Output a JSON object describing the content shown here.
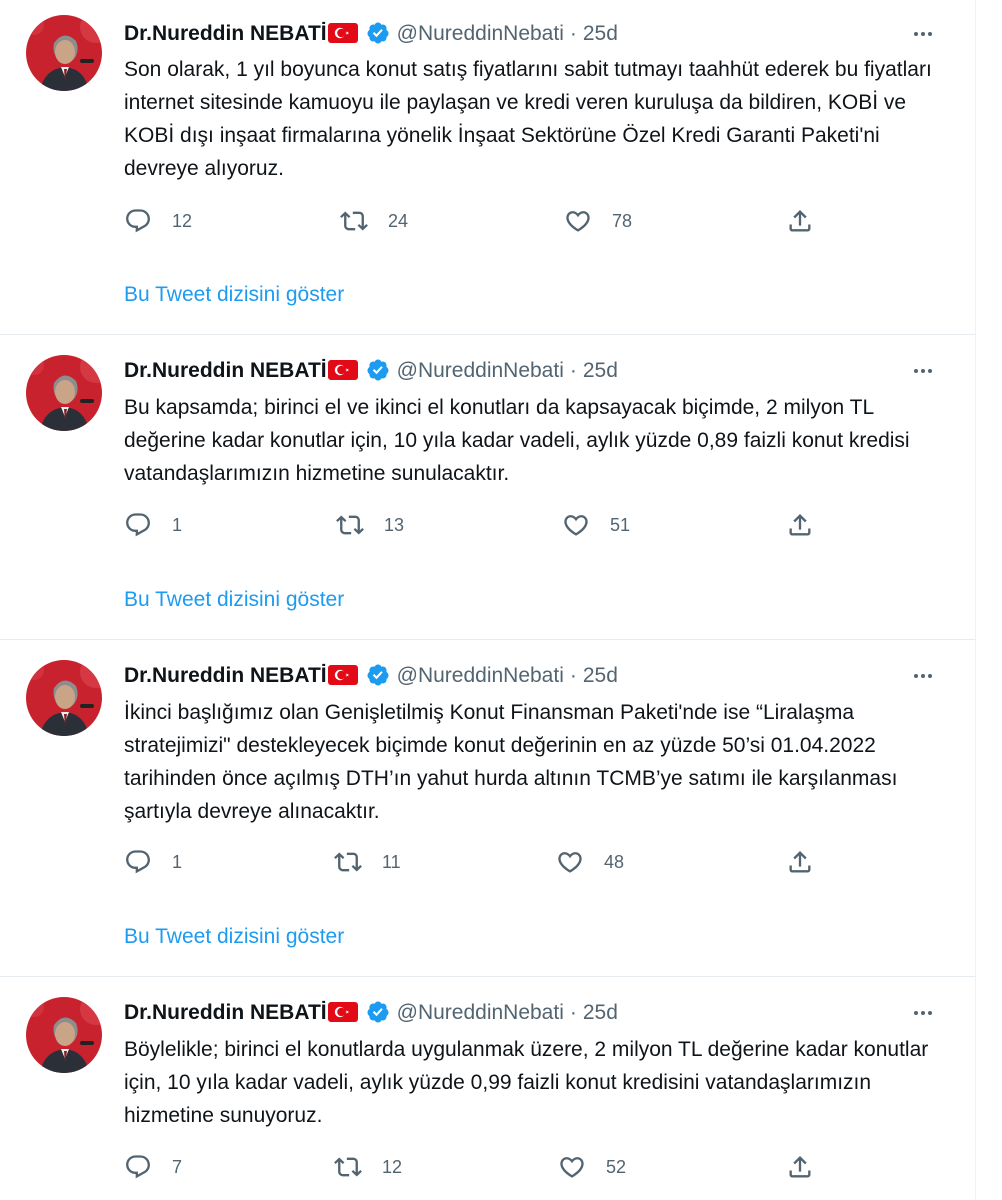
{
  "colors": {
    "link": "#1d9bf0",
    "secondary": "#536471",
    "verified": "#1d9bf0",
    "flag": "#e30a17"
  },
  "icons": {
    "reply": "reply-icon",
    "retweet": "retweet-icon",
    "like": "heart-icon",
    "share": "share-icon",
    "more": "more-icon",
    "verified": "verified-badge-icon",
    "flag": "turkey-flag-icon"
  },
  "tweets": [
    {
      "name": "Dr.Nureddin NEBATİ",
      "handle": "@NureddinNebati",
      "dot": "·",
      "time": "25d",
      "text": "Son olarak, 1 yıl boyunca konut satış fiyatlarını sabit tutmayı taahhüt ederek bu fiyatları internet sitesinde kamuoyu ile paylaşan ve kredi veren kuruluşa da bildiren, KOBİ ve KOBİ dışı inşaat firmalarına yönelik İnşaat Sektörüne Özel Kredi Garanti Paketi'ni devreye alıyoruz.",
      "replies": "12",
      "retweets": "24",
      "likes": "78",
      "thread_link": "Bu Tweet dizisini göster"
    },
    {
      "name": "Dr.Nureddin NEBATİ",
      "handle": "@NureddinNebati",
      "dot": "·",
      "time": "25d",
      "text": "Bu kapsamda; birinci el ve ikinci el konutları da kapsayacak biçimde, 2 milyon TL değerine kadar konutlar için, 10 yıla kadar vadeli, aylık yüzde 0,89 faizli konut kredisi vatandaşlarımızın hizmetine sunulacaktır.",
      "replies": "1",
      "retweets": "13",
      "likes": "51",
      "thread_link": "Bu Tweet dizisini göster"
    },
    {
      "name": "Dr.Nureddin NEBATİ",
      "handle": "@NureddinNebati",
      "dot": "·",
      "time": "25d",
      "text": "İkinci başlığımız olan Genişletilmiş Konut Finansman Paketi'nde ise “Liralaşma stratejimizi\" destekleyecek biçimde konut değerinin en az yüzde 50’si 01.04.2022 tarihinden önce açılmış DTH’ın yahut hurda altının TCMB’ye satımı ile karşılanması şartıyla devreye alınacaktır.",
      "replies": "1",
      "retweets": "11",
      "likes": "48",
      "thread_link": "Bu Tweet dizisini göster"
    },
    {
      "name": "Dr.Nureddin NEBATİ",
      "handle": "@NureddinNebati",
      "dot": "·",
      "time": "25d",
      "text": "Böylelikle; birinci el konutlarda uygulanmak üzere, 2 milyon TL değerine kadar konutlar için, 10 yıla kadar vadeli, aylık yüzde 0,99 faizli konut kredisini vatandaşlarımızın hizmetine sunuyoruz.",
      "replies": "7",
      "retweets": "12",
      "likes": "52"
    }
  ]
}
